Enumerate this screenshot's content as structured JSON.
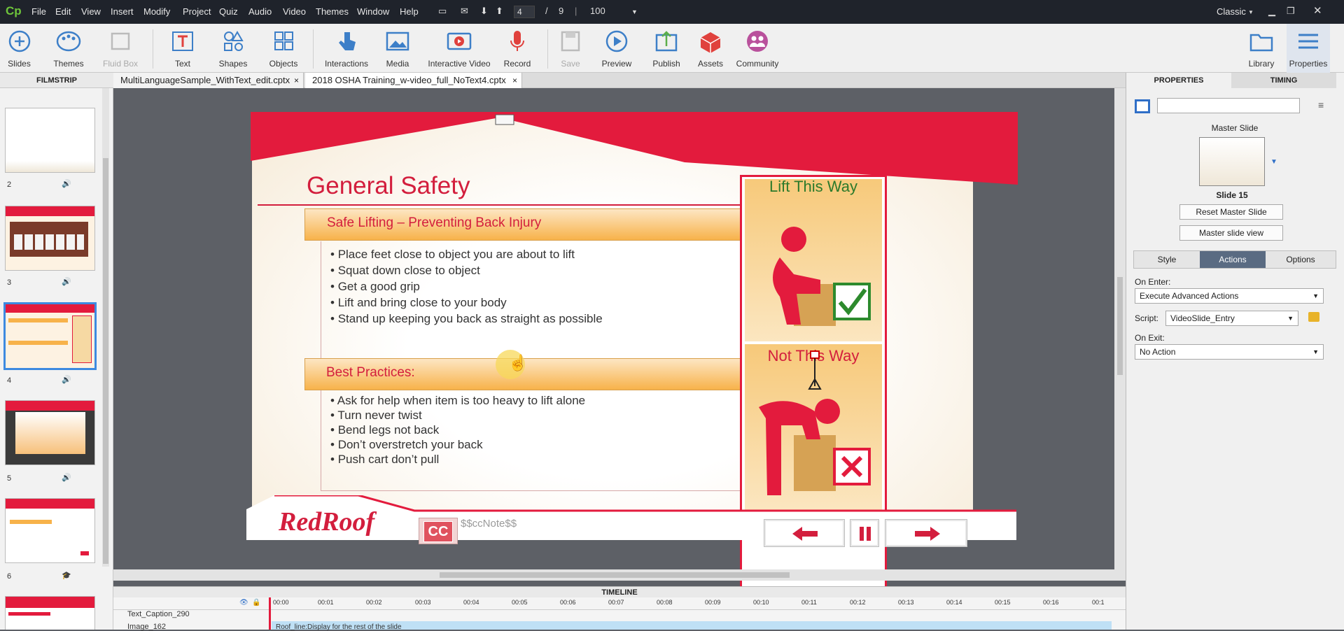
{
  "app": {
    "logo": "Cp",
    "menu": [
      "File",
      "Edit",
      "View",
      "Insert",
      "Modify",
      "Project",
      "Quiz",
      "Audio",
      "Video",
      "Themes",
      "Window",
      "Help"
    ],
    "page_current": "4",
    "page_sep": "/",
    "page_total": "9",
    "zoom": "100",
    "workspace": "Classic"
  },
  "toolbar": {
    "items": [
      "Slides",
      "Themes",
      "Fluid Box",
      "Text",
      "Shapes",
      "Objects",
      "Interactions",
      "Media",
      "Interactive Video",
      "Record",
      "Save",
      "Preview",
      "Publish",
      "Assets",
      "Community",
      "Library",
      "Properties"
    ]
  },
  "filmstrip": {
    "title": "FILMSTRIP",
    "slides": [
      {
        "num": "2"
      },
      {
        "num": "3"
      },
      {
        "num": "4"
      },
      {
        "num": "5"
      },
      {
        "num": "6"
      }
    ]
  },
  "tabs": [
    {
      "label": "MultiLanguageSample_WithText_edit.cptx",
      "close": "×"
    },
    {
      "label": "2018 OSHA Training_w-video_full_NoText4.cptx",
      "close": "×"
    }
  ],
  "slide": {
    "title": "General Safety",
    "section1": "Safe Lifting – Preventing Back Injury",
    "bullets1": [
      "Place feet close to object you are about to lift",
      "Squat down close to object",
      "Get a good grip",
      "Lift and bring close to your body",
      "Stand up keeping you back as straight as possible"
    ],
    "section2": "Best Practices:",
    "bullets2": [
      "Ask for help when item is too heavy to lift alone",
      "Turn never twist",
      "Bend legs not back",
      "Don’t overstretch your back",
      "Push cart don’t pull"
    ],
    "right_top": "Lift This Way",
    "right_bottom": "Not This Way",
    "logo": "RedRoof",
    "cc": "CC",
    "cc_var": "$$ccNote$$"
  },
  "panel": {
    "tab_properties": "PROPERTIES",
    "tab_timing": "TIMING",
    "master_label": "Master Slide",
    "slide_name": "Slide 15",
    "reset_btn": "Reset Master Slide",
    "view_btn": "Master slide view",
    "subtabs": [
      "Style",
      "Actions",
      "Options"
    ],
    "on_enter_label": "On Enter:",
    "on_enter_value": "Execute Advanced Actions",
    "script_label": "Script:",
    "script_value": "VideoSlide_Entry",
    "on_exit_label": "On Exit:",
    "on_exit_value": "No Action"
  },
  "timeline": {
    "title": "TIMELINE",
    "ticks": [
      "00:00",
      "00:01",
      "00:02",
      "00:03",
      "00:04",
      "00:05",
      "00:06",
      "00:07",
      "00:08",
      "00:09",
      "00:10",
      "00:11",
      "00:12",
      "00:13",
      "00:14",
      "00:15",
      "00:16",
      "00:1"
    ],
    "rows": [
      "Text_Caption_290",
      "Image_162"
    ],
    "bar_text": "Roof_line:Display for the rest of the slide"
  },
  "colors": {
    "accent": "#e31b3d",
    "orange": "#f7b24a",
    "dark": "#1f232b"
  }
}
